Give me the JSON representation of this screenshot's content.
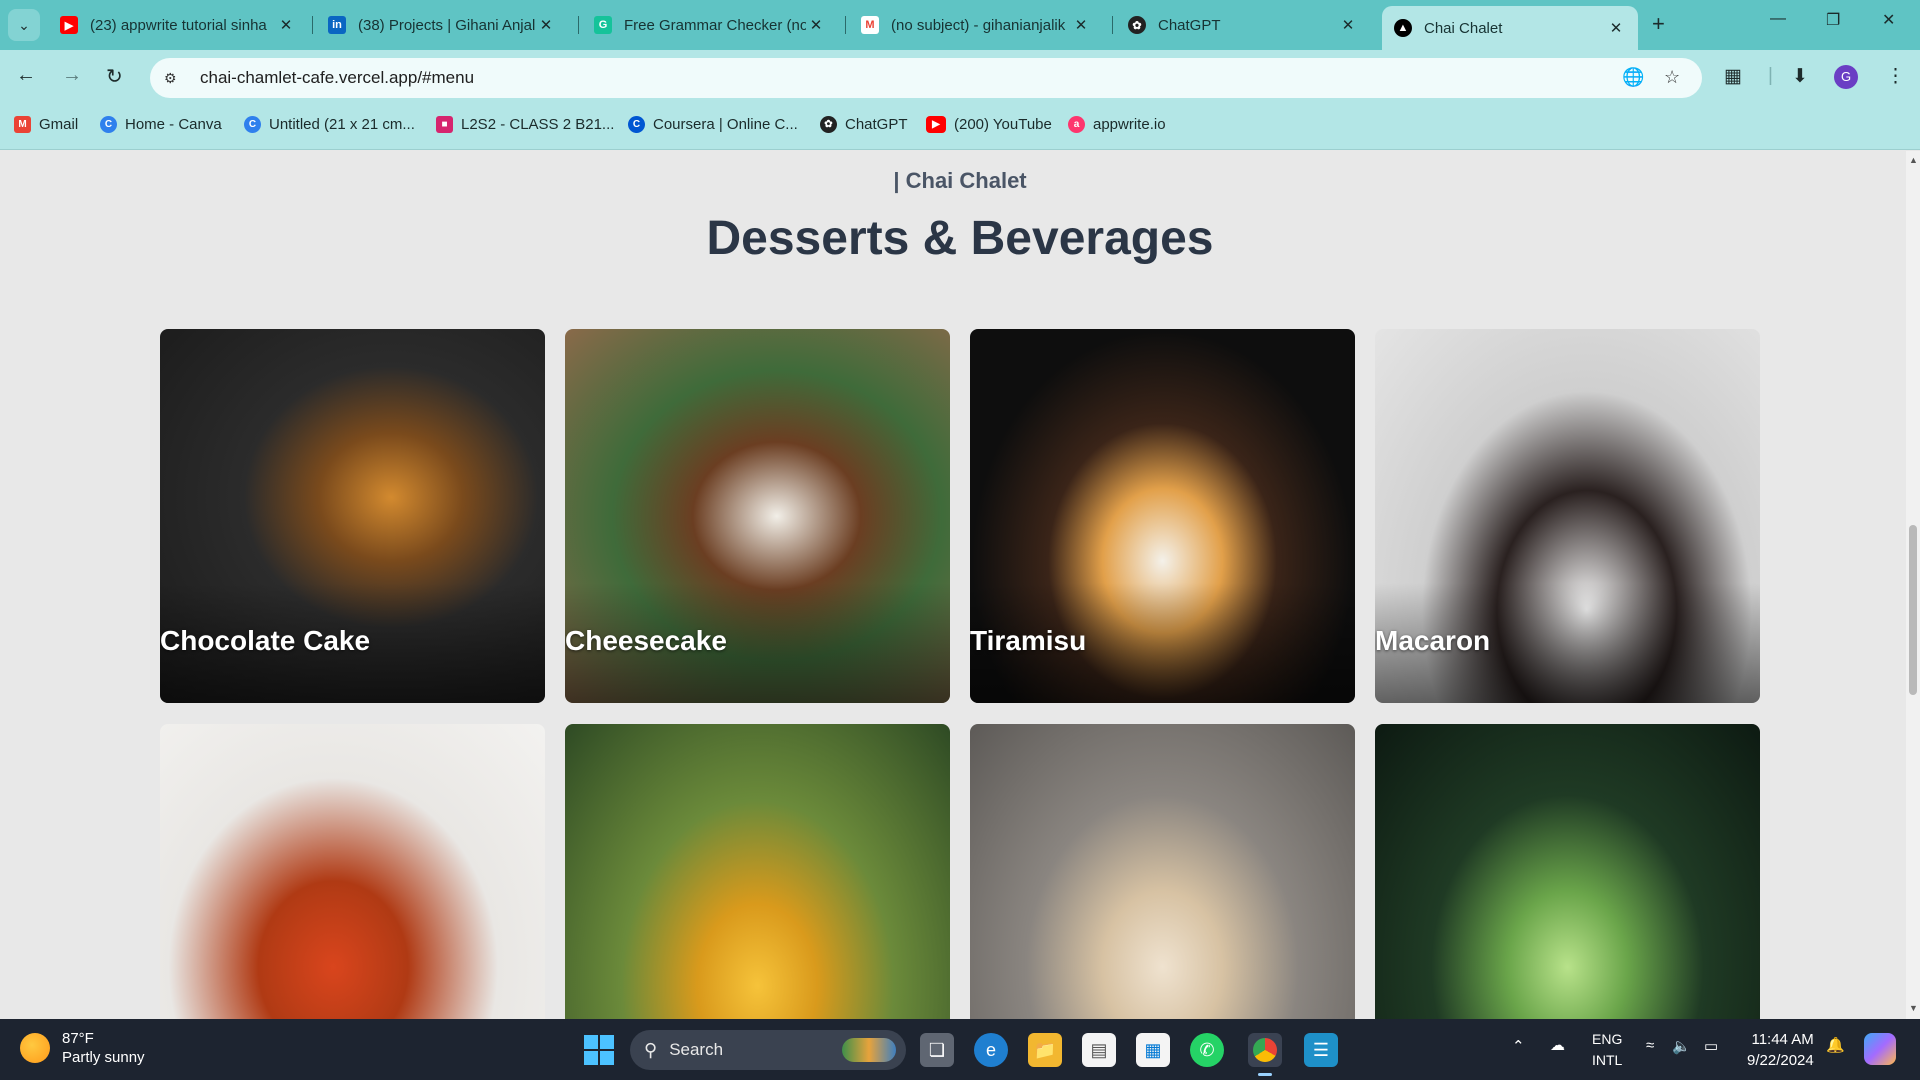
{
  "browser": {
    "tabs": [
      {
        "title": "(23) appwrite tutorial sinha",
        "icon": "youtube-icon",
        "color": "#ff0000"
      },
      {
        "title": "(38) Projects | Gihani Anjal",
        "icon": "linkedin-icon",
        "color": "#0a66c2"
      },
      {
        "title": "Free Grammar Checker (no",
        "icon": "grammar-icon",
        "color": "#15c39a"
      },
      {
        "title": "(no subject) - gihanianjalik",
        "icon": "gmail-icon",
        "color": "#ea4335"
      },
      {
        "title": "ChatGPT",
        "icon": "chatgpt-icon",
        "color": "#222222"
      },
      {
        "title": "Chai Chalet",
        "icon": "vercel-icon",
        "color": "#000000",
        "active": true
      }
    ],
    "url": "chai-chamlet-cafe.vercel.app/#menu",
    "profile_initial": "G",
    "bookmarks": [
      {
        "label": "Gmail",
        "icon": "gmail-icon",
        "color": "#ea4335"
      },
      {
        "label": "Home - Canva",
        "icon": "canva-icon",
        "color": "#2f80ed"
      },
      {
        "label": "Untitled (21 x 21 cm...",
        "icon": "canva-icon",
        "color": "#2f80ed"
      },
      {
        "label": "L2S2 - CLASS 2 B21...",
        "icon": "classroom-icon",
        "color": "#d6246e"
      },
      {
        "label": "Coursera | Online C...",
        "icon": "coursera-icon",
        "color": "#0056d2"
      },
      {
        "label": "ChatGPT",
        "icon": "chatgpt-icon",
        "color": "#222222"
      },
      {
        "label": "(200) YouTube",
        "icon": "youtube-icon",
        "color": "#ff0000"
      },
      {
        "label": "appwrite.io",
        "icon": "appwrite-icon",
        "color": "#fd366e"
      }
    ]
  },
  "page": {
    "subtitle": "| Chai Chalet",
    "heading": "Desserts & Beverages",
    "menu_items": [
      {
        "label": "Chocolate Cake",
        "image": "chocolate-cake-photo"
      },
      {
        "label": "Cheesecake",
        "image": "cheesecake-photo"
      },
      {
        "label": "Tiramisu",
        "image": "tiramisu-photo"
      },
      {
        "label": "Macaron",
        "image": "macaron-photo"
      },
      {
        "label": "",
        "image": "iced-tea-photo"
      },
      {
        "label": "",
        "image": "mango-juice-photo"
      },
      {
        "label": "",
        "image": "milkshake-photo"
      },
      {
        "label": "",
        "image": "mojito-photo"
      }
    ]
  },
  "taskbar": {
    "temperature": "87°F",
    "weather": "Partly sunny",
    "search_label": "Search",
    "lang_line1": "ENG",
    "lang_line2": "INTL",
    "time": "11:44 AM",
    "date": "9/22/2024"
  }
}
